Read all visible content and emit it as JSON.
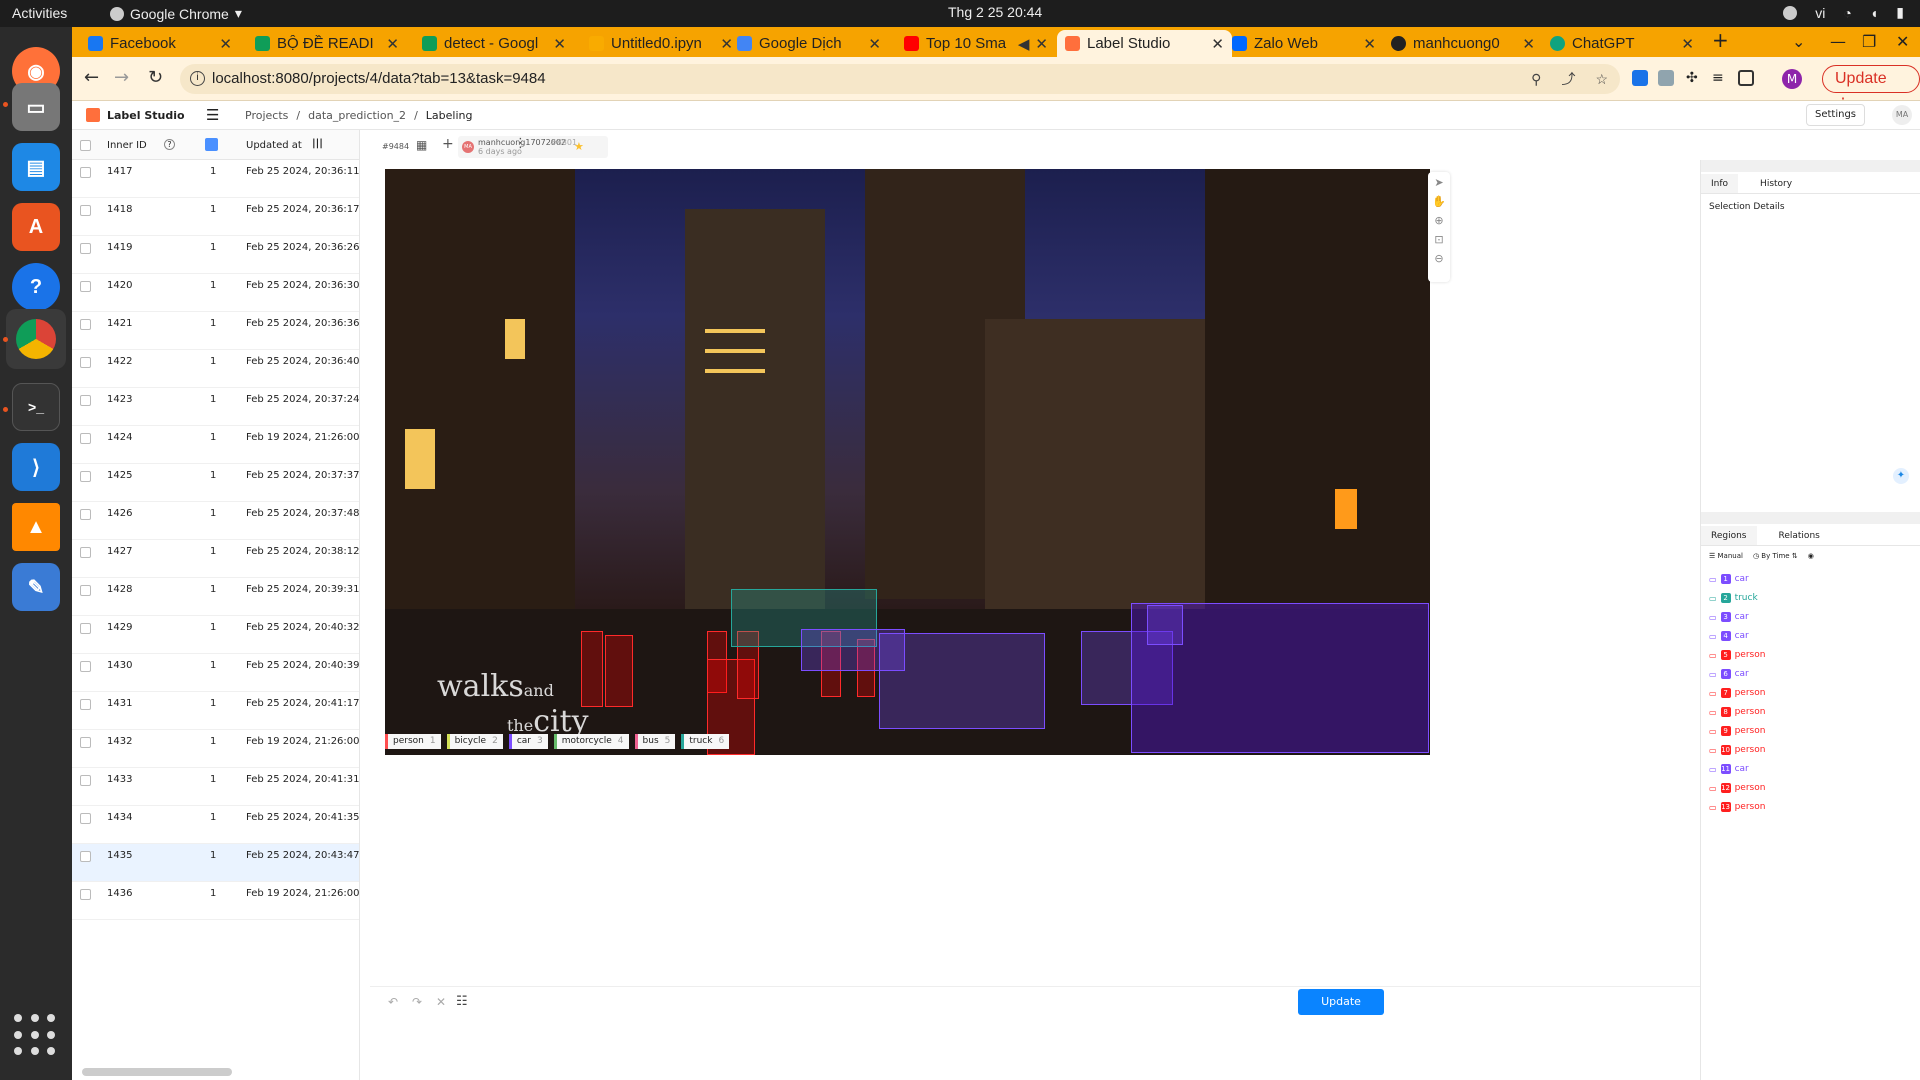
{
  "topbar": {
    "activities": "Activities",
    "app": "Google Chrome",
    "clock": "Thg 2 25  20:44",
    "lang": "vi"
  },
  "tabs": [
    {
      "title": "Facebook",
      "color": "#1877f2"
    },
    {
      "title": "BỘ ĐỀ READI",
      "color": "#0f9d58"
    },
    {
      "title": "detect - Googl",
      "color": "#0f9d58"
    },
    {
      "title": "Untitled0.ipyn",
      "color": "#f9ab00"
    },
    {
      "title": "Google Dịch",
      "color": "#4285f4"
    },
    {
      "title": "Top 10 Sma",
      "color": "#ff0000"
    },
    {
      "title": "Label Studio",
      "color": "#ff6f3c"
    },
    {
      "title": "Zalo Web",
      "color": "#0068ff"
    },
    {
      "title": "manhcuong0",
      "color": "#222222"
    },
    {
      "title": "ChatGPT",
      "color": "#10a37f"
    }
  ],
  "address": "localhost:8080/projects/4/data?tab=13&task=9484",
  "chrome_update": "Update",
  "profile_initial": "M",
  "ls": {
    "name": "Label Studio",
    "crumbs": [
      "Projects",
      "/",
      "data_prediction_2",
      "/",
      "Labeling"
    ],
    "settings": "Settings",
    "avatar": "MA"
  },
  "dm": {
    "col_id": "Inner ID",
    "col_updated": "Updated at",
    "rows": [
      {
        "id": "1417",
        "n": "1",
        "date": "Feb 25 2024, 20:36:11"
      },
      {
        "id": "1418",
        "n": "1",
        "date": "Feb 25 2024, 20:36:17"
      },
      {
        "id": "1419",
        "n": "1",
        "date": "Feb 25 2024, 20:36:26"
      },
      {
        "id": "1420",
        "n": "1",
        "date": "Feb 25 2024, 20:36:30"
      },
      {
        "id": "1421",
        "n": "1",
        "date": "Feb 25 2024, 20:36:36"
      },
      {
        "id": "1422",
        "n": "1",
        "date": "Feb 25 2024, 20:36:40"
      },
      {
        "id": "1423",
        "n": "1",
        "date": "Feb 25 2024, 20:37:24"
      },
      {
        "id": "1424",
        "n": "1",
        "date": "Feb 19 2024, 21:26:00"
      },
      {
        "id": "1425",
        "n": "1",
        "date": "Feb 25 2024, 20:37:37"
      },
      {
        "id": "1426",
        "n": "1",
        "date": "Feb 25 2024, 20:37:48"
      },
      {
        "id": "1427",
        "n": "1",
        "date": "Feb 25 2024, 20:38:12"
      },
      {
        "id": "1428",
        "n": "1",
        "date": "Feb 25 2024, 20:39:31"
      },
      {
        "id": "1429",
        "n": "1",
        "date": "Feb 25 2024, 20:40:32"
      },
      {
        "id": "1430",
        "n": "1",
        "date": "Feb 25 2024, 20:40:39"
      },
      {
        "id": "1431",
        "n": "1",
        "date": "Feb 25 2024, 20:41:17"
      },
      {
        "id": "1432",
        "n": "1",
        "date": "Feb 19 2024, 21:26:00"
      },
      {
        "id": "1433",
        "n": "1",
        "date": "Feb 25 2024, 20:41:31"
      },
      {
        "id": "1434",
        "n": "1",
        "date": "Feb 25 2024, 20:41:35"
      },
      {
        "id": "1435",
        "n": "1",
        "date": "Feb 25 2024, 20:43:47"
      },
      {
        "id": "1436",
        "n": "1",
        "date": "Feb 19 2024, 21:26:00"
      }
    ],
    "selected_id": "1435"
  },
  "labeling": {
    "task_id": "#9484",
    "annotator": "manhcuong17072002",
    "annotation_id": "#8801",
    "ago": "6 days ago",
    "watermark_main": "walks",
    "watermark_and": "and",
    "watermark_the": "the",
    "watermark_city": "city",
    "labels": [
      {
        "name": "person",
        "key": "1",
        "color": "#ff4d4f"
      },
      {
        "name": "bicycle",
        "key": "2",
        "color": "#d4e157"
      },
      {
        "name": "car",
        "key": "3",
        "color": "#7c4dff"
      },
      {
        "name": "motorcycle",
        "key": "4",
        "color": "#66bb6a"
      },
      {
        "name": "bus",
        "key": "5",
        "color": "#f06292"
      },
      {
        "name": "truck",
        "key": "6",
        "color": "#26a69a"
      }
    ],
    "update": "Update"
  },
  "panel": {
    "tab_info": "Info",
    "tab_history": "History",
    "selection_details": "Selection Details",
    "tab_regions": "Regions",
    "tab_relations": "Relations",
    "sort_manual": "Manual",
    "sort_bytime": "By Time",
    "regions": [
      {
        "n": "1",
        "label": "car",
        "color": "#7c4dff"
      },
      {
        "n": "2",
        "label": "truck",
        "color": "#26a69a"
      },
      {
        "n": "3",
        "label": "car",
        "color": "#7c4dff"
      },
      {
        "n": "4",
        "label": "car",
        "color": "#7c4dff"
      },
      {
        "n": "5",
        "label": "person",
        "color": "#ff1f1f"
      },
      {
        "n": "6",
        "label": "car",
        "color": "#7c4dff"
      },
      {
        "n": "7",
        "label": "person",
        "color": "#ff1f1f"
      },
      {
        "n": "8",
        "label": "person",
        "color": "#ff1f1f"
      },
      {
        "n": "9",
        "label": "person",
        "color": "#ff1f1f"
      },
      {
        "n": "10",
        "label": "person",
        "color": "#ff1f1f"
      },
      {
        "n": "11",
        "label": "car",
        "color": "#7c4dff"
      },
      {
        "n": "12",
        "label": "person",
        "color": "#ff1f1f"
      },
      {
        "n": "13",
        "label": "person",
        "color": "#ff1f1f"
      }
    ]
  }
}
